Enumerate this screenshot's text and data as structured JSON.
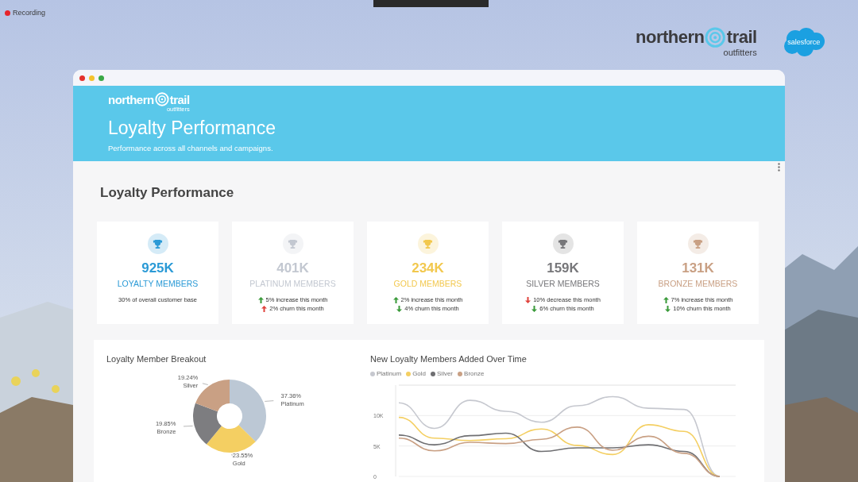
{
  "recording": {
    "label": "Recording"
  },
  "brand": {
    "left": "northern",
    "right": "trail",
    "tagline": "outfitters"
  },
  "partner": {
    "label": "salesforce"
  },
  "window": {
    "header": {
      "logo": {
        "left": "northern",
        "right": "trail",
        "tagline": "outfitters"
      },
      "title": "Loyalty Performance",
      "subtitle": "Performance across all channels and campaigns."
    },
    "heading": "Loyalty Performance",
    "cards": [
      {
        "value": "925K",
        "label": "LOYALTY MEMBERS",
        "color": "#2b9ad6",
        "notes": [
          {
            "kind": "plain",
            "text": "30% of overall customer base"
          }
        ]
      },
      {
        "value": "401K",
        "label": "PLATINUM MEMBERS",
        "color": "#c3c8d1",
        "notes": [
          {
            "kind": "up",
            "color": "#3a9a3a",
            "text": "5% increase this month"
          },
          {
            "kind": "up",
            "color": "#e0423c",
            "text": "2% churn this month"
          }
        ]
      },
      {
        "value": "234K",
        "label": "GOLD MEMBERS",
        "color": "#f2c84e",
        "notes": [
          {
            "kind": "up",
            "color": "#3a9a3a",
            "text": "2% increase this month"
          },
          {
            "kind": "down",
            "color": "#3a9a3a",
            "text": "4% churn this month"
          }
        ]
      },
      {
        "value": "159K",
        "label": "SILVER MEMBERS",
        "color": "#77777a",
        "notes": [
          {
            "kind": "down",
            "color": "#e0423c",
            "text": "10% decrease this month"
          },
          {
            "kind": "down",
            "color": "#3a9a3a",
            "text": "6% churn this month"
          }
        ]
      },
      {
        "value": "131K",
        "label": "BRONZE MEMBERS",
        "color": "#c9a084",
        "notes": [
          {
            "kind": "up",
            "color": "#3a9a3a",
            "text": "7% increase this month"
          },
          {
            "kind": "down",
            "color": "#3a9a3a",
            "text": "10% churn this month"
          }
        ]
      }
    ],
    "breakout": {
      "chart_data": {
        "type": "donut",
        "title": "Loyalty Member Breakout",
        "categories": [
          "Platinum",
          "Gold",
          "Bronze",
          "Silver"
        ],
        "values": [
          37.36,
          23.55,
          19.85,
          19.24
        ],
        "colors": [
          "#bcc8d5",
          "#f4cf62",
          "#7d7d80",
          "#c9a084"
        ],
        "value_labels": [
          "37.36%",
          "23.55%",
          "19.85%",
          "19.24%"
        ]
      }
    },
    "trend": {
      "chart_data": {
        "type": "line",
        "title": "New Loyalty Members Added Over Time",
        "legend": "top",
        "ylim": [
          0,
          15000
        ],
        "yticks": [
          {
            "value": 0,
            "label": "0"
          },
          {
            "value": 5000,
            "label": "5K"
          },
          {
            "value": 10000,
            "label": "10K"
          }
        ],
        "series": [
          {
            "name": "Platinum",
            "color": "#c6c8cf",
            "values": [
              12100,
              7900,
              12500,
              10700,
              8900,
              11600,
              13100,
              11200,
              11000,
              0
            ]
          },
          {
            "name": "Gold",
            "color": "#f4cf62",
            "values": [
              9700,
              6300,
              5900,
              6200,
              7800,
              5100,
              3600,
              8500,
              7400,
              0
            ]
          },
          {
            "name": "Silver",
            "color": "#6f6f72",
            "values": [
              6800,
              5200,
              6700,
              7100,
              4100,
              4700,
              4700,
              5200,
              4100,
              0
            ]
          },
          {
            "name": "Bronze",
            "color": "#c9a084",
            "values": [
              6300,
              4200,
              5600,
              5400,
              6100,
              8100,
              4300,
              6600,
              3800,
              0
            ]
          }
        ]
      }
    }
  }
}
